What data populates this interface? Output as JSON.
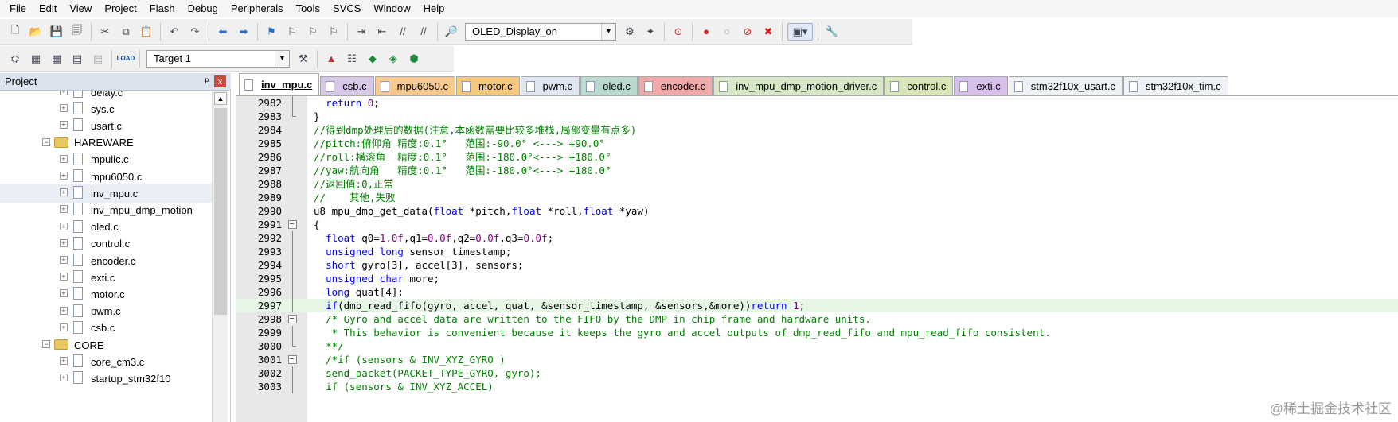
{
  "menu": [
    "File",
    "Edit",
    "View",
    "Project",
    "Flash",
    "Debug",
    "Peripherals",
    "Tools",
    "SVCS",
    "Window",
    "Help"
  ],
  "toolbar": {
    "project_select": "OLED_Display_on",
    "target_select": "Target 1",
    "load_label": "LOAD"
  },
  "project_panel": {
    "title": "Project",
    "pin": "ᵖ",
    "close": "x",
    "tree": [
      {
        "label": "delay.c",
        "type": "file",
        "depth": 2
      },
      {
        "label": "sys.c",
        "type": "file",
        "depth": 2
      },
      {
        "label": "usart.c",
        "type": "file",
        "depth": 2
      },
      {
        "label": "HAREWARE",
        "type": "folder",
        "depth": 1
      },
      {
        "label": "mpuiic.c",
        "type": "file",
        "depth": 2
      },
      {
        "label": "mpu6050.c",
        "type": "file",
        "depth": 2
      },
      {
        "label": "inv_mpu.c",
        "type": "file",
        "depth": 2,
        "selected": true
      },
      {
        "label": "inv_mpu_dmp_motion",
        "type": "file",
        "depth": 2
      },
      {
        "label": "oled.c",
        "type": "file",
        "depth": 2
      },
      {
        "label": "control.c",
        "type": "file",
        "depth": 2
      },
      {
        "label": "encoder.c",
        "type": "file",
        "depth": 2
      },
      {
        "label": "exti.c",
        "type": "file",
        "depth": 2
      },
      {
        "label": "motor.c",
        "type": "file",
        "depth": 2
      },
      {
        "label": "pwm.c",
        "type": "file",
        "depth": 2
      },
      {
        "label": "csb.c",
        "type": "file",
        "depth": 2
      },
      {
        "label": "CORE",
        "type": "folder",
        "depth": 1
      },
      {
        "label": "core_cm3.c",
        "type": "file",
        "depth": 2
      },
      {
        "label": "startup_stm32f10",
        "type": "file",
        "depth": 2
      }
    ]
  },
  "tabs": [
    {
      "label": "inv_mpu.c",
      "color": "#ffffff",
      "active": true
    },
    {
      "label": "csb.c",
      "color": "#d8c8e8"
    },
    {
      "label": "mpu6050.c",
      "color": "#f7c98f"
    },
    {
      "label": "motor.c",
      "color": "#f5c87c"
    },
    {
      "label": "pwm.c",
      "color": "#dfe6f2"
    },
    {
      "label": "oled.c",
      "color": "#b8d8d0"
    },
    {
      "label": "encoder.c",
      "color": "#f0a8a8"
    },
    {
      "label": "inv_mpu_dmp_motion_driver.c",
      "color": "#d6e8c8"
    },
    {
      "label": "control.c",
      "color": "#d8e6b8"
    },
    {
      "label": "exti.c",
      "color": "#d8c0ec"
    },
    {
      "label": "stm32f10x_usart.c",
      "color": "#eef1f6"
    },
    {
      "label": "stm32f10x_tim.c",
      "color": "#eef1f6"
    }
  ],
  "code_lines": [
    {
      "num": "2982",
      "fold": "bar",
      "tokens": [
        [
          "",
          "  "
        ],
        [
          "kw",
          "return"
        ],
        [
          "",
          " "
        ],
        [
          "num",
          "0"
        ],
        [
          "",
          ";"
        ]
      ]
    },
    {
      "num": "2983",
      "fold": "end",
      "tokens": [
        [
          "",
          "}"
        ]
      ]
    },
    {
      "num": "2984",
      "fold": "",
      "tokens": [
        [
          "cm",
          "//得到dmp处理后的数据(注意,本函数需要比较多堆栈,局部变量有点多)"
        ]
      ]
    },
    {
      "num": "2985",
      "fold": "",
      "tokens": [
        [
          "cm",
          "//pitch:俯仰角 精度:0.1°   范围:-90.0° <---> +90.0°"
        ]
      ]
    },
    {
      "num": "2986",
      "fold": "",
      "tokens": [
        [
          "cm",
          "//roll:横滚角  精度:0.1°   范围:-180.0°<---> +180.0°"
        ]
      ]
    },
    {
      "num": "2987",
      "fold": "",
      "tokens": [
        [
          "cm",
          "//yaw:航向角   精度:0.1°   范围:-180.0°<---> +180.0°"
        ]
      ]
    },
    {
      "num": "2988",
      "fold": "",
      "tokens": [
        [
          "cm",
          "//返回值:0,正常"
        ]
      ]
    },
    {
      "num": "2989",
      "fold": "",
      "tokens": [
        [
          "cm",
          "//    其他,失败"
        ]
      ]
    },
    {
      "num": "2990",
      "fold": "",
      "tokens": [
        [
          "",
          "u8 mpu_dmp_get_data("
        ],
        [
          "kw",
          "float"
        ],
        [
          "",
          " *pitch,"
        ],
        [
          "kw",
          "float"
        ],
        [
          "",
          " *roll,"
        ],
        [
          "kw",
          "float"
        ],
        [
          "",
          " *yaw)"
        ]
      ]
    },
    {
      "num": "2991",
      "fold": "box",
      "tokens": [
        [
          "",
          "{"
        ]
      ]
    },
    {
      "num": "2992",
      "fold": "bar",
      "tokens": [
        [
          "",
          "  "
        ],
        [
          "kw",
          "float"
        ],
        [
          "",
          " q0="
        ],
        [
          "num",
          "1.0f"
        ],
        [
          "",
          ",q1="
        ],
        [
          "num",
          "0.0f"
        ],
        [
          "",
          ",q2="
        ],
        [
          "num",
          "0.0f"
        ],
        [
          "",
          ",q3="
        ],
        [
          "num",
          "0.0f"
        ],
        [
          "",
          ";"
        ]
      ]
    },
    {
      "num": "2993",
      "fold": "bar",
      "tokens": [
        [
          "",
          "  "
        ],
        [
          "kw",
          "unsigned long"
        ],
        [
          "",
          " sensor_timestamp;"
        ]
      ]
    },
    {
      "num": "2994",
      "fold": "bar",
      "tokens": [
        [
          "",
          "  "
        ],
        [
          "kw",
          "short"
        ],
        [
          "",
          " gyro[3], accel[3], sensors;"
        ]
      ]
    },
    {
      "num": "2995",
      "fold": "bar",
      "tokens": [
        [
          "",
          "  "
        ],
        [
          "kw",
          "unsigned char"
        ],
        [
          "",
          " more;"
        ]
      ]
    },
    {
      "num": "2996",
      "fold": "bar",
      "tokens": [
        [
          "",
          "  "
        ],
        [
          "kw",
          "long"
        ],
        [
          "",
          " quat[4];"
        ]
      ]
    },
    {
      "num": "2997",
      "fold": "bar",
      "highlight": true,
      "tokens": [
        [
          "",
          "  "
        ],
        [
          "kw",
          "if"
        ],
        [
          "",
          "(dmp_read_fifo(gyro, accel, quat, &sensor_timestamp, &sensors,&more))"
        ],
        [
          "kw",
          "return"
        ],
        [
          "",
          " "
        ],
        [
          "num",
          "1"
        ],
        [
          "",
          ";"
        ]
      ]
    },
    {
      "num": "2998",
      "fold": "box",
      "tokens": [
        [
          "",
          "  "
        ],
        [
          "cm",
          "/* Gyro and accel data are written to the FIFO by the DMP in chip frame and hardware units."
        ]
      ]
    },
    {
      "num": "2999",
      "fold": "bar",
      "tokens": [
        [
          "",
          "  "
        ],
        [
          "cm",
          " * This behavior is convenient because it keeps the gyro and accel outputs of dmp_read_fifo and mpu_read_fifo consistent."
        ]
      ]
    },
    {
      "num": "3000",
      "fold": "end",
      "tokens": [
        [
          "",
          "  "
        ],
        [
          "cm",
          "**/"
        ]
      ]
    },
    {
      "num": "3001",
      "fold": "box",
      "tokens": [
        [
          "",
          "  "
        ],
        [
          "cm",
          "/*if (sensors & INV_XYZ_GYRO )"
        ]
      ]
    },
    {
      "num": "3002",
      "fold": "bar",
      "tokens": [
        [
          "",
          "  "
        ],
        [
          "cm",
          "send_packet(PACKET_TYPE_GYRO, gyro);"
        ]
      ]
    },
    {
      "num": "3003",
      "fold": "bar",
      "tokens": [
        [
          "",
          "  "
        ],
        [
          "cm",
          "if (sensors & INV_XYZ_ACCEL)"
        ]
      ]
    }
  ],
  "watermark": "@稀土掘金技术社区"
}
